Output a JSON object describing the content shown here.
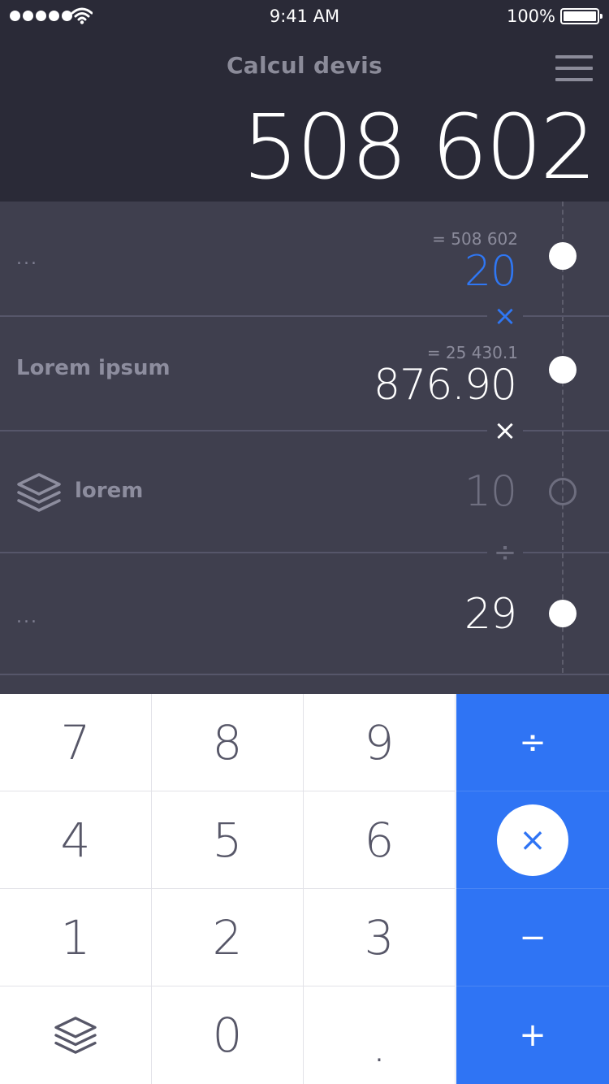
{
  "status": {
    "time": "9:41 AM",
    "battery": "100%"
  },
  "header": {
    "title": "Calcul devis",
    "total": "508 602"
  },
  "rows": [
    {
      "label": "...",
      "subtotal": "= 508 602",
      "value": "20",
      "operator": "×"
    },
    {
      "label": "Lorem ipsum",
      "subtotal": "= 25 430.1",
      "value": "876.90",
      "operator": "×"
    },
    {
      "label": "lorem",
      "value": "10",
      "operator": "÷"
    },
    {
      "label": "...",
      "value": "29"
    }
  ],
  "keypad": {
    "digits": [
      "7",
      "8",
      "9",
      "4",
      "5",
      "6",
      "1",
      "2",
      "3",
      "0",
      "."
    ],
    "operators": [
      "÷",
      "×",
      "−",
      "+"
    ]
  },
  "colors": {
    "accent": "#2f74f4",
    "header_bg": "#2a2a37",
    "rows_bg": "#3f3f4e"
  },
  "icons": [
    "wifi-icon",
    "menu-icon",
    "layers-icon"
  ]
}
